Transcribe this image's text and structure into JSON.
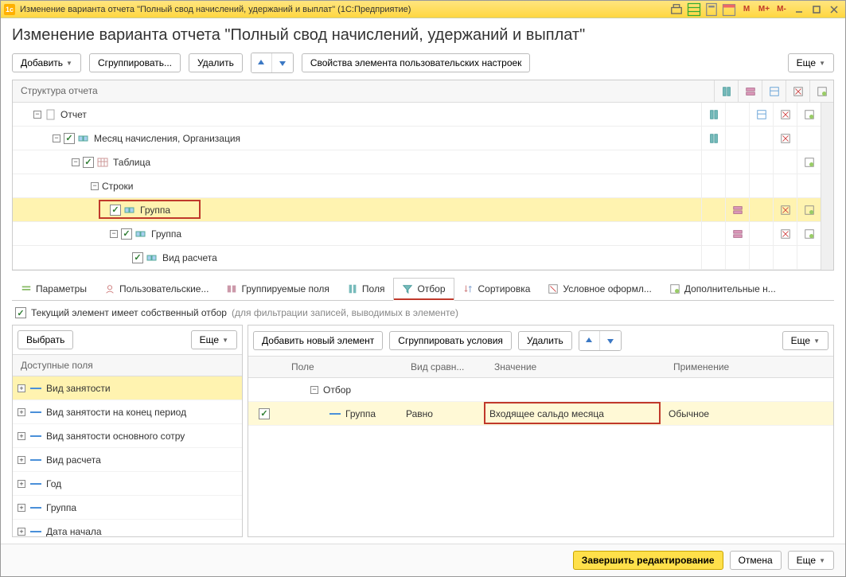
{
  "titlebar": {
    "text": "Изменение варианта отчета \"Полный свод начислений, удержаний и выплат\"  (1С:Предприятие)",
    "m_buttons": [
      "M",
      "M+",
      "M-"
    ]
  },
  "heading": "Изменение варианта отчета \"Полный свод начислений, удержаний и выплат\"",
  "toolbar": {
    "add": "Добавить",
    "group": "Сгруппировать...",
    "delete": "Удалить",
    "props": "Свойства элемента пользовательских настроек",
    "more": "Еще"
  },
  "tree": {
    "header": "Структура отчета",
    "rows": [
      {
        "indent": 1,
        "expand": "-",
        "chk": false,
        "icon": "doc",
        "label": "Отчет"
      },
      {
        "indent": 2,
        "expand": "-",
        "chk": true,
        "icon": "grp",
        "label": "Месяц начисления, Организация"
      },
      {
        "indent": 3,
        "expand": "-",
        "chk": true,
        "icon": "tbl",
        "label": "Таблица"
      },
      {
        "indent": 4,
        "expand": "-",
        "chk": false,
        "icon": "",
        "label": "Строки"
      },
      {
        "indent": 5,
        "expand": "",
        "chk": true,
        "icon": "grp",
        "label": "Группа",
        "hl": true,
        "boxed": true
      },
      {
        "indent": 5,
        "expand": "-",
        "chk": true,
        "icon": "grp",
        "label": "Группа"
      },
      {
        "indent": 6,
        "expand": "",
        "chk": true,
        "icon": "grp",
        "label": "Вид расчета"
      }
    ]
  },
  "tabs": [
    {
      "label": "Параметры",
      "icon": "params"
    },
    {
      "label": "Пользовательские...",
      "icon": "user"
    },
    {
      "label": "Группируемые поля",
      "icon": "group"
    },
    {
      "label": "Поля",
      "icon": "fields"
    },
    {
      "label": "Отбор",
      "icon": "filter",
      "active": true
    },
    {
      "label": "Сортировка",
      "icon": "sort"
    },
    {
      "label": "Условное оформл...",
      "icon": "cond"
    },
    {
      "label": "Дополнительные н...",
      "icon": "extra"
    }
  ],
  "filter": {
    "label": "Текущий элемент имеет собственный отбор",
    "note": "(для фильтрации записей, выводимых в элементе)"
  },
  "left": {
    "select": "Выбрать",
    "more": "Еще",
    "header": "Доступные поля",
    "items": [
      {
        "label": "Вид занятости",
        "hl": true
      },
      {
        "label": "Вид занятости на конец период"
      },
      {
        "label": "Вид занятости основного сотру"
      },
      {
        "label": "Вид расчета"
      },
      {
        "label": "Год"
      },
      {
        "label": "Группа"
      },
      {
        "label": "Дата начала"
      }
    ]
  },
  "right": {
    "add": "Добавить новый элемент",
    "group": "Сгруппировать условия",
    "delete": "Удалить",
    "more": "Еще",
    "cols": {
      "field": "Поле",
      "comp": "Вид сравн...",
      "value": "Значение",
      "apply": "Применение"
    },
    "parent": "Отбор",
    "row": {
      "field": "Группа",
      "comp": "Равно",
      "value": "Входящее сальдо месяца",
      "apply": "Обычное"
    }
  },
  "footer": {
    "finish": "Завершить редактирование",
    "cancel": "Отмена",
    "more": "Еще"
  }
}
